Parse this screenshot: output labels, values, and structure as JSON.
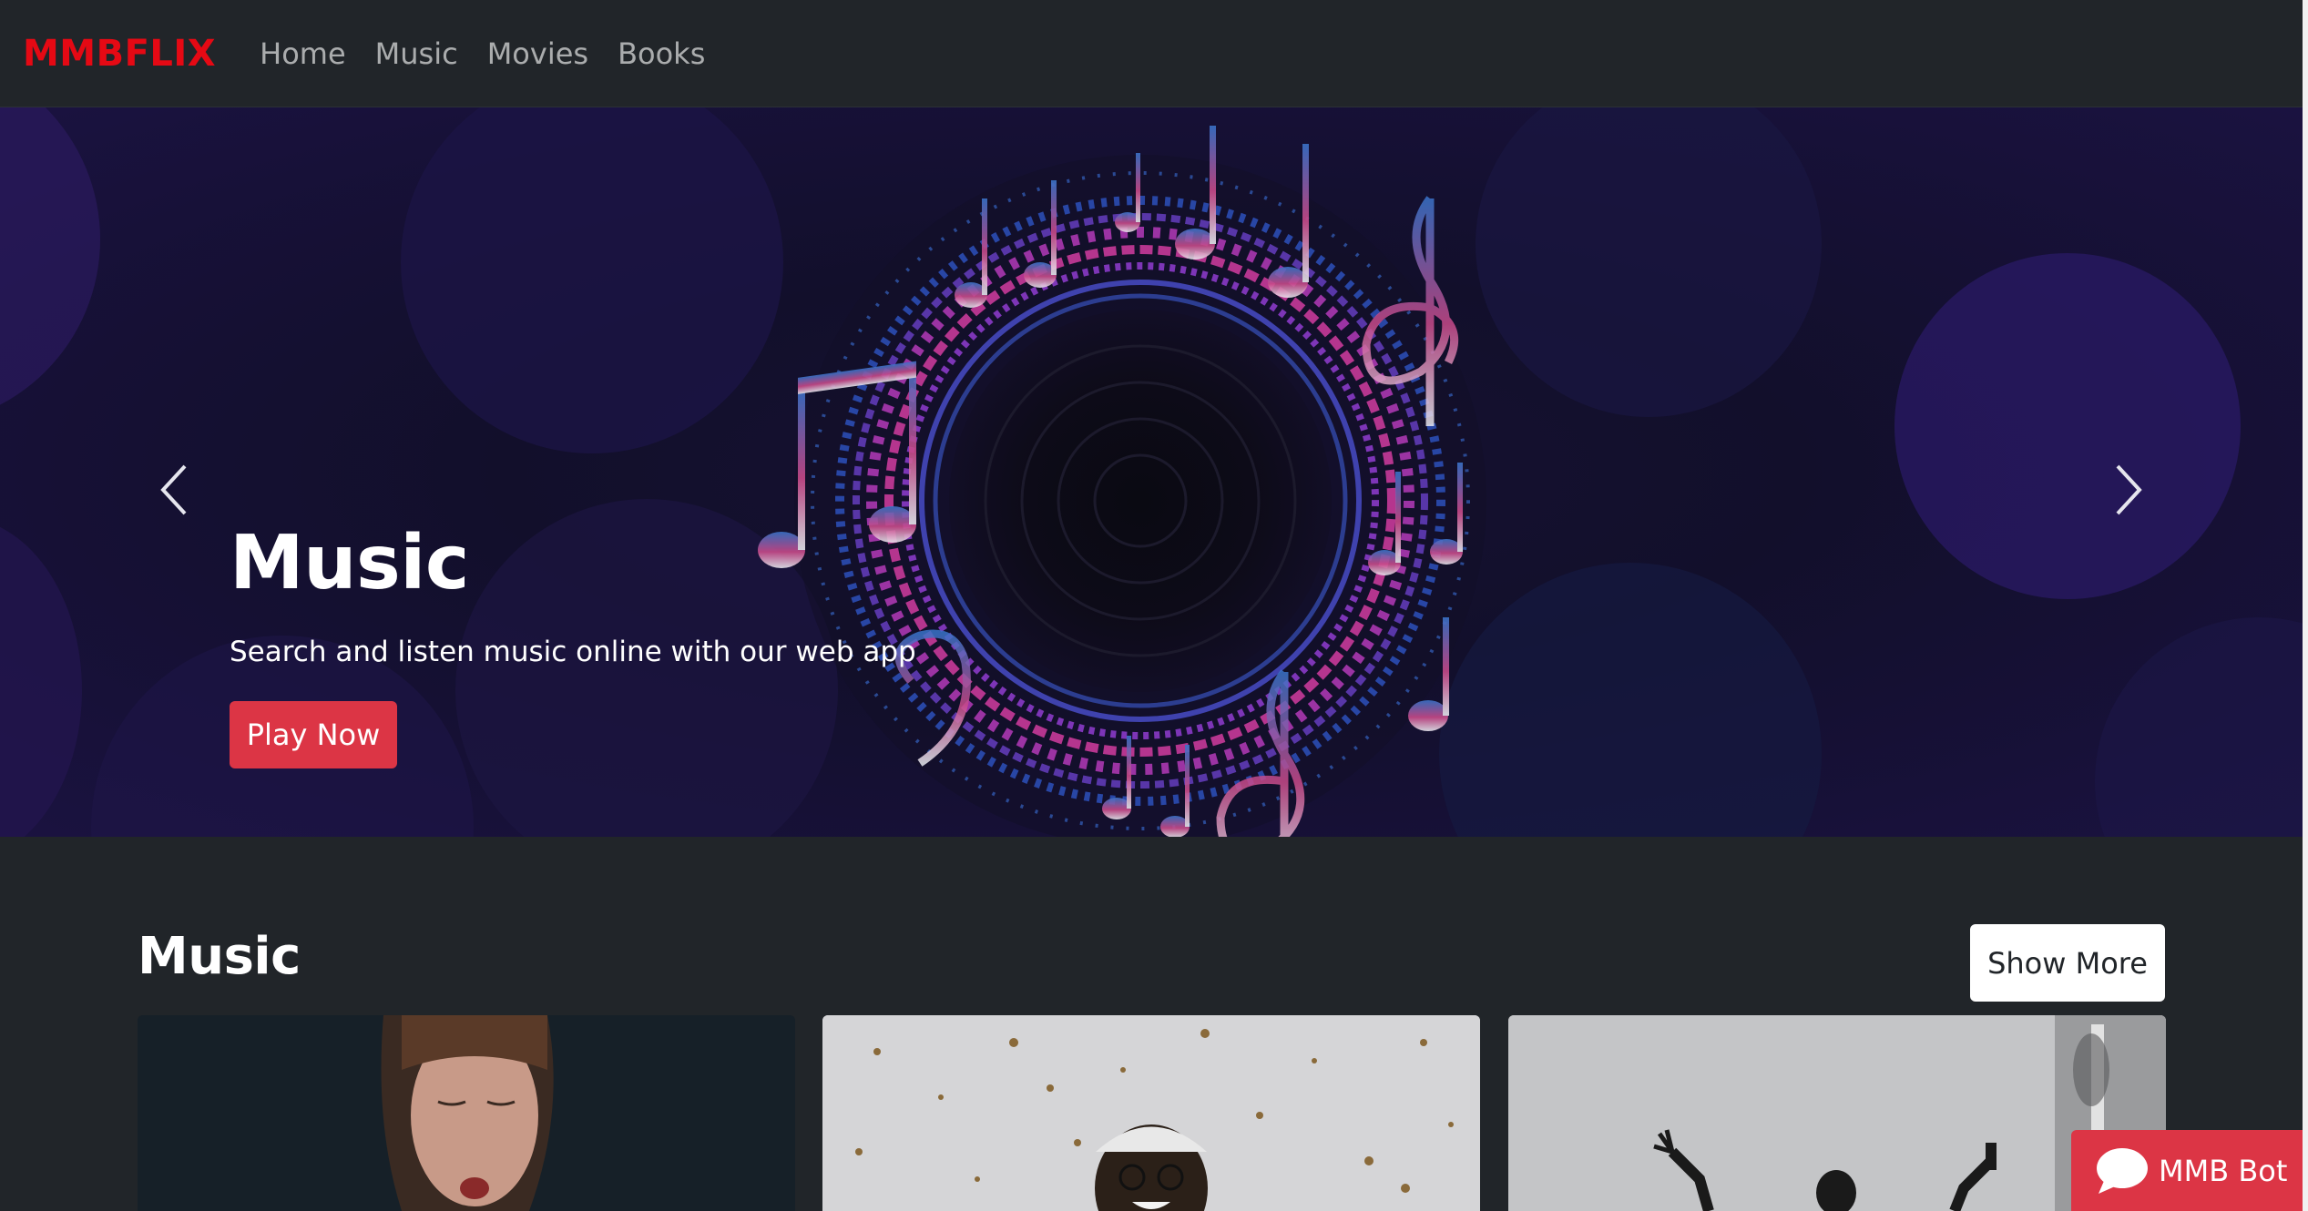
{
  "navbar": {
    "brand": "MMBFLIX",
    "links": [
      "Home",
      "Music",
      "Movies",
      "Books"
    ]
  },
  "hero": {
    "title": "Music",
    "subtitle": "Search and listen music online with our web app",
    "cta_label": "Play Now"
  },
  "section": {
    "title": "Music",
    "show_more_label": "Show More"
  },
  "bot": {
    "label": "MMB Bot"
  },
  "colors": {
    "brand": "#e50914",
    "accent": "#dc3545",
    "background": "#212529"
  },
  "icons": {
    "carousel_prev": "chevron-left-icon",
    "carousel_next": "chevron-right-icon",
    "bot": "chat-bubble-icon"
  }
}
